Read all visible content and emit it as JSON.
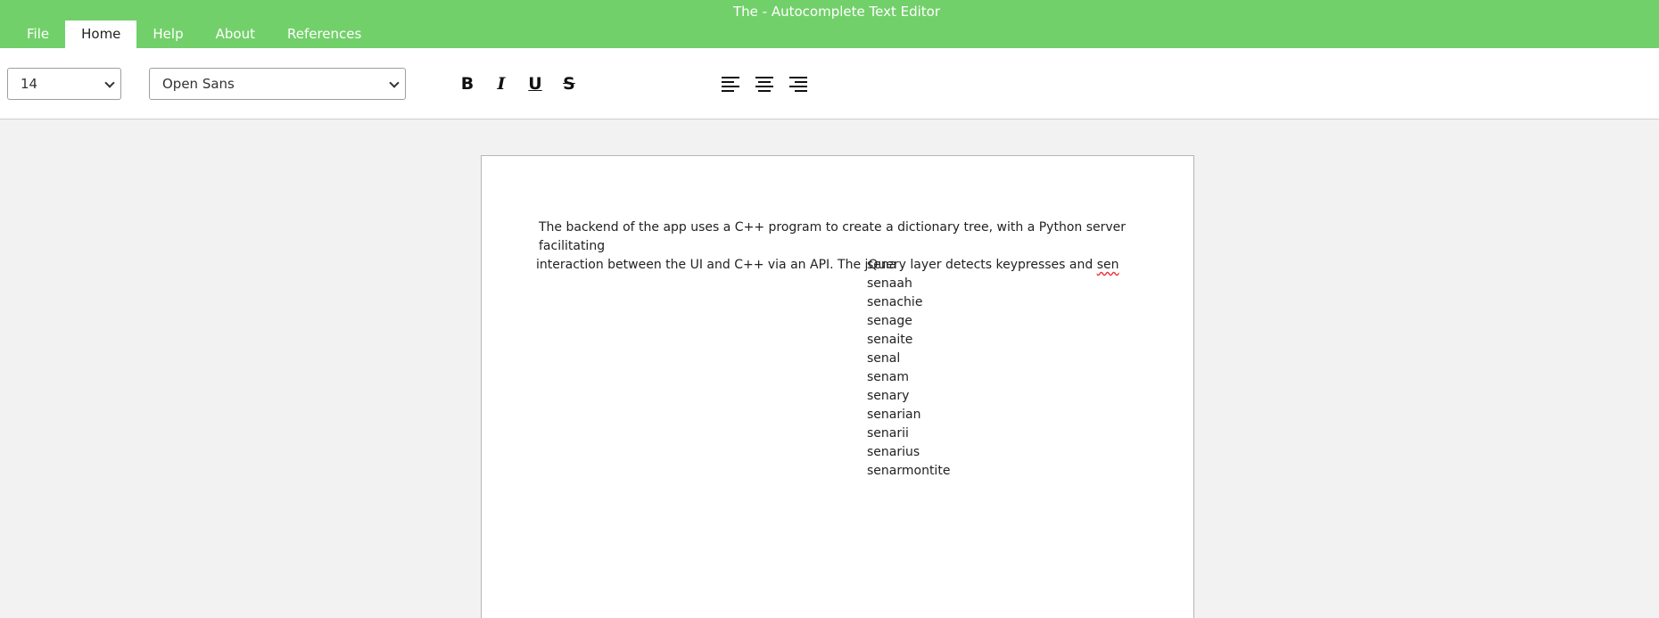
{
  "window": {
    "title": "The - Autocomplete Text Editor"
  },
  "menu": {
    "tabs": [
      {
        "label": "File"
      },
      {
        "label": "Home"
      },
      {
        "label": "Help"
      },
      {
        "label": "About"
      },
      {
        "label": "References"
      }
    ],
    "active_tab": "Home"
  },
  "toolbar": {
    "font_size": {
      "value": "14"
    },
    "font_family": {
      "value": "Open Sans"
    },
    "bold_label": "B",
    "italic_label": "I",
    "underline_label": "U",
    "strikethrough_label": "S",
    "icons": [
      "bold-icon",
      "italic-icon",
      "underline-icon",
      "strikethrough-icon",
      "align-left-icon",
      "align-center-icon",
      "align-right-icon"
    ]
  },
  "document": {
    "line1": "The backend of the app uses a C++ program to create a dictionary tree, with a Python server facilitating",
    "line2_prefix": "interaction between the UI and C++ via an API. The jQuery layer detects keypresses and ",
    "typed_word": "sen"
  },
  "autocomplete": {
    "suggestions": [
      "sena",
      "senaah",
      "senachie",
      "senage",
      "senaite",
      "senal",
      "senam",
      "senary",
      "senarian",
      "senarii",
      "senarius",
      "senarmontite"
    ]
  },
  "colors": {
    "accent": "#72d06a",
    "page_background": "#f2f2f2",
    "spellcheck_underline": "#e33333"
  }
}
